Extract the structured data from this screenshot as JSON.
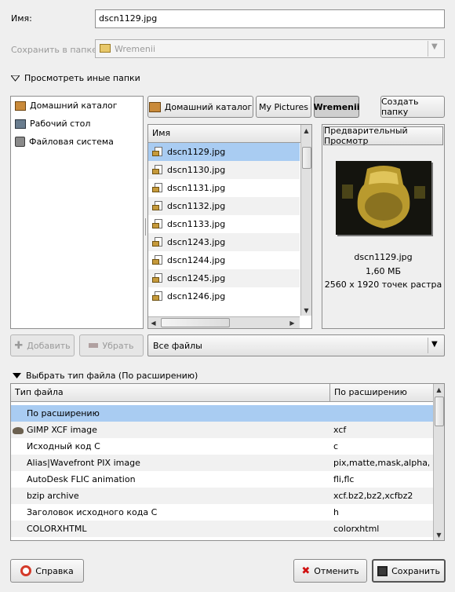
{
  "name_label": "Имя:",
  "name_value": "dscn1129.jpg",
  "save_folder_label": "Сохранить в папке",
  "save_folder_value": "Wremenii",
  "browse_toggle_label": "Просмотреть иные папки",
  "places": [
    {
      "label": "Домашний каталог",
      "icon": "home-icon"
    },
    {
      "label": "Рабочий стол",
      "icon": "desktop-icon"
    },
    {
      "label": "Файловая система",
      "icon": "harddisk-icon"
    }
  ],
  "path_buttons": [
    {
      "label": "Домашний каталог"
    },
    {
      "label": "My Pictures"
    },
    {
      "label": "Wremenii"
    }
  ],
  "create_folder_label": "Создать папку",
  "file_list": {
    "header": "Имя",
    "files": [
      "dscn1129.jpg",
      "dscn1130.jpg",
      "dscn1131.jpg",
      "dscn1132.jpg",
      "dscn1133.jpg",
      "dscn1243.jpg",
      "dscn1244.jpg",
      "dscn1245.jpg",
      "dscn1246.jpg"
    ],
    "selected_index": 0
  },
  "preview": {
    "header": "Предварительный Просмотр",
    "filename": "dscn1129.jpg",
    "size": "1,60 МБ",
    "dimensions": "2560 x 1920 точек растра"
  },
  "add_label": "Добавить",
  "remove_label": "Убрать",
  "filter_value": "Все файлы",
  "file_type_toggle_label": "Выбрать тип файла (По расширению)",
  "file_types": {
    "headers": [
      "Тип файла",
      "По расширению"
    ],
    "rows": [
      {
        "type": "По расширению",
        "ext": ""
      },
      {
        "type": "GIMP XCF image",
        "ext": "xcf"
      },
      {
        "type": "Исходный код C",
        "ext": "c"
      },
      {
        "type": "Alias|Wavefront PIX image",
        "ext": "pix,matte,mask,alpha,als"
      },
      {
        "type": "AutoDesk FLIC animation",
        "ext": "fli,flc"
      },
      {
        "type": "bzip archive",
        "ext": "xcf.bz2,bz2,xcfbz2"
      },
      {
        "type": "Заголовок исходного кода C",
        "ext": "h"
      },
      {
        "type": "COLORXHTML",
        "ext": "colorxhtml"
      }
    ],
    "selected_index": 0
  },
  "help_label": "Справка",
  "cancel_label": "Отменить",
  "save_label": "Сохранить",
  "colors": {
    "selection": "#a9ccf2",
    "window_bg": "#efefef"
  }
}
